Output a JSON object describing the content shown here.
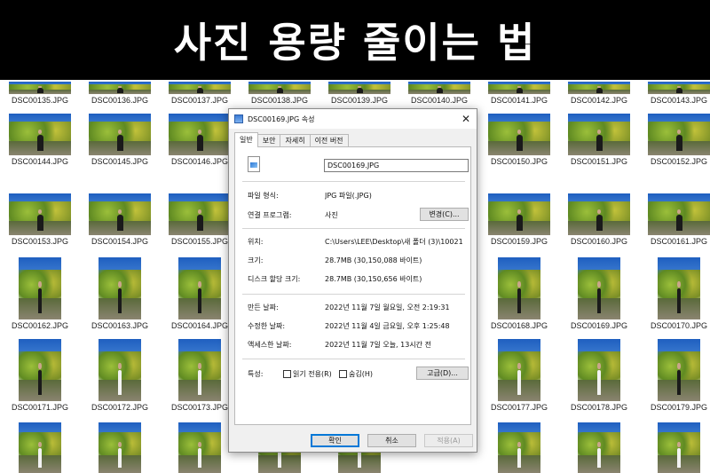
{
  "banner": {
    "text": "사진 용량 줄이는 법"
  },
  "explorer": {
    "files": [
      "DSC00135.JPG",
      "DSC00136.JPG",
      "DSC00137.JPG",
      "DSC00138.JPG",
      "DSC00139.JPG",
      "DSC00140.JPG",
      "DSC00141.JPG",
      "DSC00142.JPG",
      "DSC00143.JPG",
      "DSC00144.JPG",
      "DSC00145.JPG",
      "DSC00146.JPG",
      "DSC00150.JPG",
      "DSC00151.JPG",
      "DSC00152.JPG",
      "DSC00153.JPG",
      "DSC00154.JPG",
      "DSC00155.JPG",
      "DSC00159.JPG",
      "DSC00160.JPG",
      "DSC00161.JPG",
      "DSC00162.JPG",
      "DSC00163.JPG",
      "DSC00164.JPG",
      "DSC00168.JPG",
      "DSC00169.JPG",
      "DSC00170.JPG",
      "DSC00171.JPG",
      "DSC00172.JPG",
      "DSC00173.JPG",
      "DSC00177.JPG",
      "DSC00178.JPG",
      "DSC00179.JPG"
    ]
  },
  "dialog": {
    "title": "DSC00169.JPG 속성",
    "close_glyph": "✕",
    "tabs": [
      "일반",
      "보안",
      "자세히",
      "이전 버전"
    ],
    "file_name": "DSC00169.JPG",
    "file_type_label": "파일 형식:",
    "file_type_value": "JPG 파일(.JPG)",
    "opens_with_label": "연결 프로그램:",
    "opens_with_value": "사진",
    "change_button": "변경(C)...",
    "location_label": "위치:",
    "location_value": "C:\\Users\\LEE\\Desktop\\새 폴더 (3)\\10021",
    "size_label": "크기:",
    "size_value": "28.7MB (30,150,088 바이트)",
    "size_on_disk_label": "디스크 할당 크기:",
    "size_on_disk_value": "28.7MB (30,150,656 바이트)",
    "created_label": "만든 날짜:",
    "created_value": "2022년 11월 7일 월요일, 오전 2:19:31",
    "modified_label": "수정한 날짜:",
    "modified_value": "2022년 11월 4일 금요일, 오후 1:25:48",
    "accessed_label": "액세스한 날짜:",
    "accessed_value": "2022년 11월 7일 오늘, 13시간 전",
    "attributes_label": "특성:",
    "readonly_label": "읽기 전용(R)",
    "hidden_label": "숨김(H)",
    "advanced_button": "고급(D)...",
    "ok_button": "확인",
    "cancel_button": "취소",
    "apply_button": "적용(A)"
  },
  "colors": {
    "accent": "#0078d7",
    "banner_bg": "#000000",
    "banner_text": "#ffffff"
  }
}
